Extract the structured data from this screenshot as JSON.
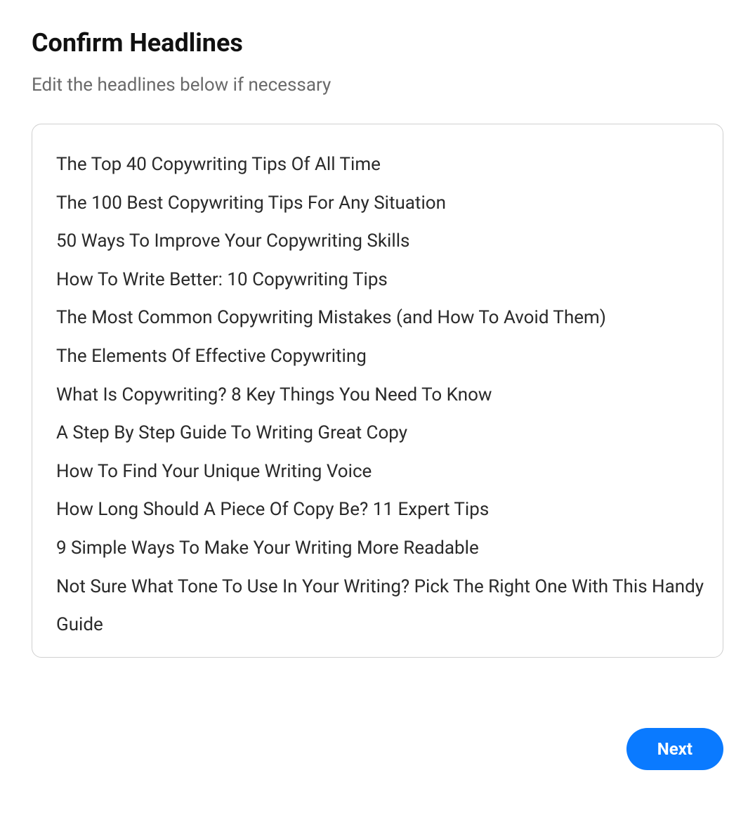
{
  "header": {
    "title": "Confirm Headlines",
    "subtitle": "Edit the headlines below if necessary"
  },
  "editor": {
    "content": "The Top 40 Copywriting Tips Of All Time\nThe 100 Best Copywriting Tips For Any Situation\n50 Ways To Improve Your Copywriting Skills\nHow To Write Better: 10 Copywriting Tips\nThe Most Common Copywriting Mistakes (and How To Avoid Them)\nThe Elements Of Effective Copywriting\nWhat Is Copywriting? 8 Key Things You Need To Know\nA Step By Step Guide To Writing Great Copy\nHow To Find Your Unique Writing Voice\nHow Long Should A Piece Of Copy Be? 11 Expert Tips\n9 Simple Ways To Make Your Writing More Readable\nNot Sure What Tone To Use In Your Writing? Pick The Right One With This Handy Guide"
  },
  "footer": {
    "next_label": "Next"
  }
}
